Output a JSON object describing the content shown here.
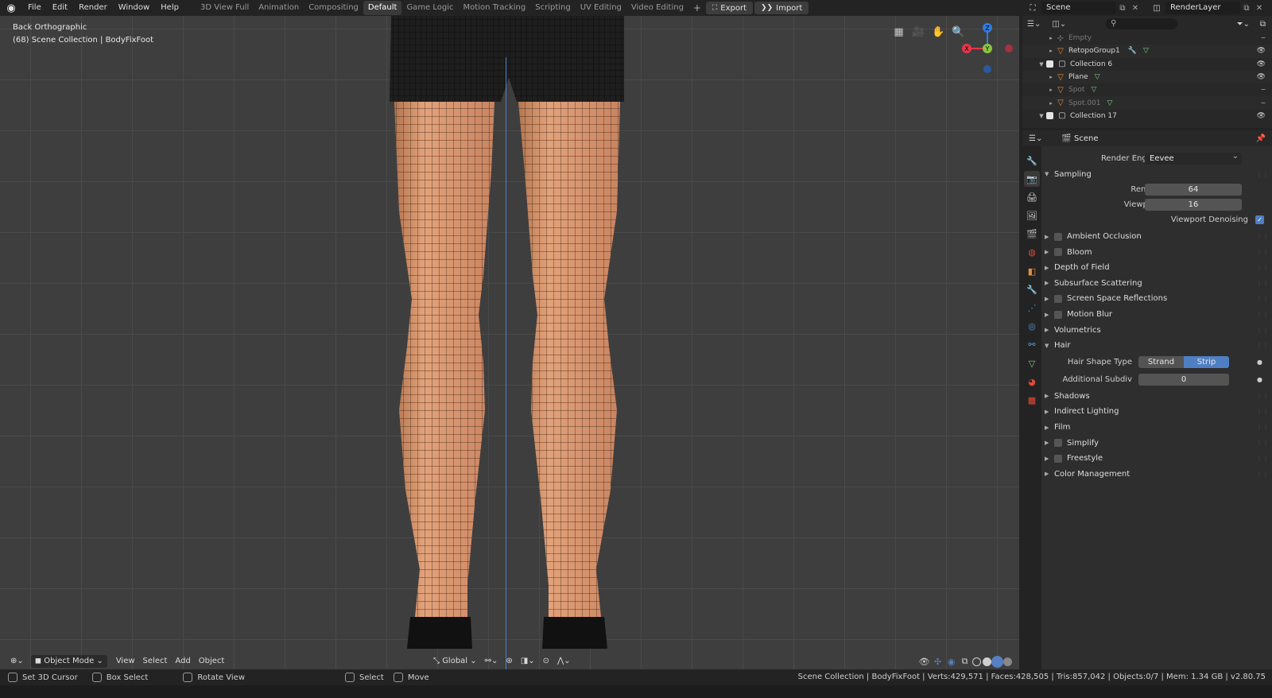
{
  "menu": [
    "File",
    "Edit",
    "Render",
    "Window",
    "Help"
  ],
  "workspaces": [
    {
      "label": "3D View Full",
      "active": false
    },
    {
      "label": "Animation",
      "active": false
    },
    {
      "label": "Compositing",
      "active": false
    },
    {
      "label": "Default",
      "active": true
    },
    {
      "label": "Game Logic",
      "active": false
    },
    {
      "label": "Motion Tracking",
      "active": false
    },
    {
      "label": "Scripting",
      "active": false
    },
    {
      "label": "UV Editing",
      "active": false
    },
    {
      "label": "Video Editing",
      "active": false
    }
  ],
  "export_label": "Export",
  "import_label": "Import",
  "scene_name": "Scene",
  "view_layer": "RenderLayer",
  "viewport": {
    "view_name": "Back Orthographic",
    "collection_info": "(68) Scene Collection | BodyFixFoot",
    "mode": "Object Mode",
    "menus": [
      "View",
      "Select",
      "Add",
      "Object"
    ],
    "orientation": "Global",
    "gizmo_labels": {
      "z": "Z",
      "y": "Y",
      "x": "X"
    }
  },
  "outliner": {
    "rows": [
      {
        "label": "Empty",
        "dim": true,
        "type": "empty",
        "indent": 2
      },
      {
        "label": "RetopoGroup1",
        "dim": false,
        "type": "mesh",
        "indent": 2
      },
      {
        "label": "Collection 6",
        "dim": false,
        "type": "collection",
        "indent": 1
      },
      {
        "label": "Plane",
        "dim": false,
        "type": "mesh",
        "indent": 2
      },
      {
        "label": "Spot",
        "dim": true,
        "type": "light",
        "indent": 2
      },
      {
        "label": "Spot.001",
        "dim": true,
        "type": "light",
        "indent": 2
      },
      {
        "label": "Collection 17",
        "dim": false,
        "type": "collection",
        "indent": 1
      }
    ]
  },
  "properties": {
    "context": "Scene",
    "render_engine_label": "Render Engine",
    "render_engine": "Eevee",
    "sampling_label": "Sampling",
    "render_label": "Render",
    "render_samples": "64",
    "viewport_label": "Viewport",
    "viewport_samples": "16",
    "viewport_denoising_label": "Viewport Denoising",
    "panels_a": [
      {
        "label": "Ambient Occlusion",
        "checkbox": true
      },
      {
        "label": "Bloom",
        "checkbox": true
      },
      {
        "label": "Depth of Field",
        "checkbox": false
      },
      {
        "label": "Subsurface Scattering",
        "checkbox": false
      },
      {
        "label": "Screen Space Reflections",
        "checkbox": true
      },
      {
        "label": "Motion Blur",
        "checkbox": true
      },
      {
        "label": "Volumetrics",
        "checkbox": false
      }
    ],
    "hair_label": "Hair",
    "hair_shape_label": "Hair Shape Type",
    "hair_shape_options": [
      "Strand",
      "Strip"
    ],
    "hair_shape_selected": "Strip",
    "additional_subdiv_label": "Additional Subdiv",
    "additional_subdiv": "0",
    "panels_b": [
      {
        "label": "Shadows",
        "checkbox": false
      },
      {
        "label": "Indirect Lighting",
        "checkbox": false
      },
      {
        "label": "Film",
        "checkbox": false
      },
      {
        "label": "Simplify",
        "checkbox": true
      },
      {
        "label": "Freestyle",
        "checkbox": true
      },
      {
        "label": "Color Management",
        "checkbox": false
      }
    ]
  },
  "status": {
    "hint1": "Set 3D Cursor",
    "hint2": "Box Select",
    "hint3": "Rotate View",
    "hint4": "Select",
    "hint5": "Move",
    "stats": "Scene Collection | BodyFixFoot | Verts:429,571 | Faces:428,505 | Tris:857,042 | Objects:0/7 | Mem: 1.34 GB | v2.80.75"
  },
  "colors": {
    "accent": "#4f7fc3",
    "axis_x": "#e8364a",
    "axis_y": "#8cc63f",
    "axis_z": "#2f7de0",
    "skin": "#d8926a"
  }
}
